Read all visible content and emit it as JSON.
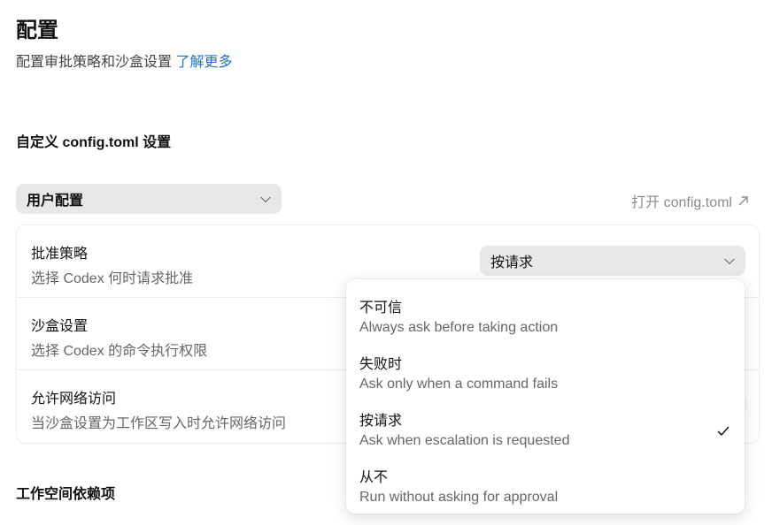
{
  "header": {
    "title": "配置",
    "subtitle": "配置审批策略和沙盒设置",
    "learn_more": "了解更多"
  },
  "config_section": {
    "title": "自定义 config.toml 设置",
    "profile_select_value": "用户配置",
    "open_config_label": "打开 config.toml"
  },
  "settings": {
    "rows": [
      {
        "label": "批准策略",
        "description": "选择 Codex 何时请求批准"
      },
      {
        "label": "沙盒设置",
        "description": "选择 Codex 的命令执行权限"
      },
      {
        "label": "允许网络访问",
        "description": "当沙盒设置为工作区写入时允许网络访问"
      }
    ],
    "approval_select_value": "按请求"
  },
  "dropdown": {
    "options": [
      {
        "title": "不可信",
        "description": "Always ask before taking action",
        "selected": false
      },
      {
        "title": "失败时",
        "description": "Ask only when a command fails",
        "selected": false
      },
      {
        "title": "按请求",
        "description": "Ask when escalation is requested",
        "selected": true
      },
      {
        "title": "从不",
        "description": "Run without asking for approval",
        "selected": false
      }
    ]
  },
  "workspace_section": {
    "title": "工作空间依赖项"
  },
  "colors": {
    "link": "#1f6fd1",
    "select_bg": "#e8e8e8",
    "muted_text": "#666666"
  },
  "icons": {
    "open_external": "arrow-up-right-icon",
    "chevron": "chevron-down-icon",
    "check": "check-icon"
  }
}
